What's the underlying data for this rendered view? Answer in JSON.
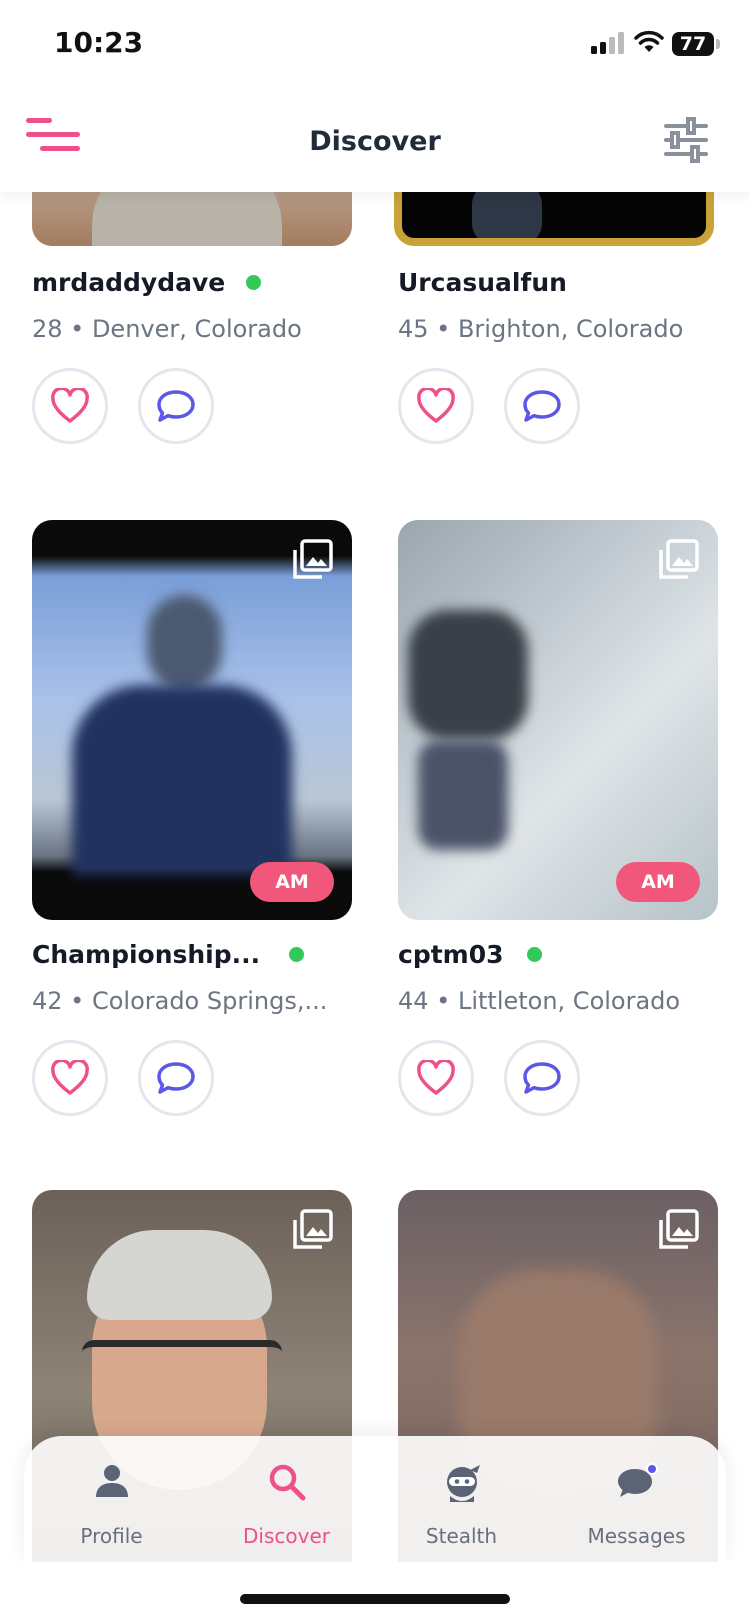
{
  "status": {
    "time": "10:23",
    "battery": "77"
  },
  "header": {
    "title": "Discover"
  },
  "profiles": [
    {
      "name": "mrdaddydave",
      "meta": "28 • Denver, Colorado",
      "online": true
    },
    {
      "name": "Urcasualfun",
      "meta": "45 • Brighton, Colorado",
      "online": false
    },
    {
      "name": "Championship...",
      "meta": "42 • Colorado Springs,...",
      "online": true,
      "badge": "AM"
    },
    {
      "name": "cptm03",
      "meta": "44 • Littleton, Colorado",
      "online": true,
      "badge": "AM"
    }
  ],
  "tabs": [
    {
      "label": "Profile",
      "icon": "person-icon"
    },
    {
      "label": "Discover",
      "icon": "search-icon",
      "active": true
    },
    {
      "label": "Stealth",
      "icon": "ninja-icon"
    },
    {
      "label": "Messages",
      "icon": "chat-bubble-icon"
    }
  ],
  "colors": {
    "accent": "#ef4f8a",
    "online": "#34c759",
    "chat": "#5b57e8",
    "gold": "#c9a23a"
  }
}
